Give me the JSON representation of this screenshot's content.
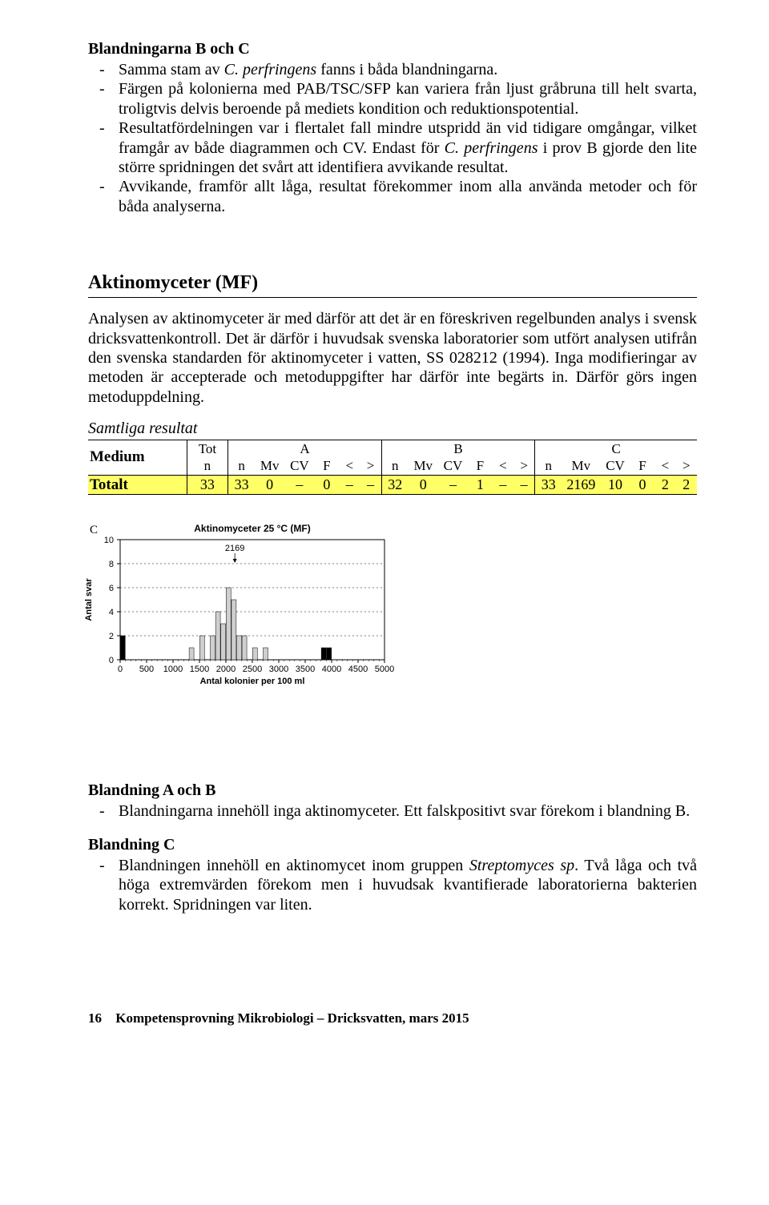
{
  "top": {
    "heading1": "Blandningarna B och C",
    "b1": "Samma stam av ",
    "b1_italic": "C. perfringens",
    "b1_tail": " fanns i båda blandningarna.",
    "b2": "Färgen på kolonierna med PAB/TSC/SFP kan variera från ljust gråbruna till helt svarta, troligtvis delvis beroende på mediets kondition och reduktionspotential.",
    "b3_a": "Resultatfördelningen var i flertalet fall mindre utspridd än vid tidigare omgångar, vilket framgår av både diagrammen och CV. Endast för ",
    "b3_italic": "C. perfringens",
    "b3_b": " i prov B gjorde den lite större spridningen det svårt att identifiera avvikande resultat.",
    "b4": "Avvikande, framför allt låga, resultat förekommer inom alla använda metoder och för båda analyserna."
  },
  "mid": {
    "heading": "Aktinomyceter (MF)",
    "para": "Analysen av aktinomyceter är med därför att det är en föreskriven regelbunden analys i svensk dricksvattenkontroll. Det är därför i huvudsak svenska laboratorier som utfört analysen utifrån den svenska standarden för aktinomyceter i vatten, SS 028212 (1994). Inga modifieringar av metoden är accepterade och metoduppgifter har därför inte begärts in. Därför görs ingen metoduppdelning.",
    "samtliga": "Samtliga resultat"
  },
  "table": {
    "medium": "Medium",
    "tot": "Tot",
    "A": "A",
    "B": "B",
    "C": "C",
    "n": "n",
    "Mv": "Mv",
    "CV": "CV",
    "F": "F",
    "lt": "<",
    "gt": ">",
    "row_label": "Totalt",
    "tot_n": "33",
    "A_vals": {
      "n": "33",
      "Mv": "0",
      "CV": "–",
      "F": "0",
      "lt": "–",
      "gt": "–"
    },
    "B_vals": {
      "n": "32",
      "Mv": "0",
      "CV": "–",
      "F": "1",
      "lt": "–",
      "gt": "–"
    },
    "C_vals": {
      "n": "33",
      "Mv": "2169",
      "CV": "10",
      "F": "0",
      "lt": "2",
      "gt": "2"
    }
  },
  "chart_data": {
    "type": "bar",
    "title": "Aktinomyceter 25 °C (MF)",
    "panel_label": "C",
    "annotation_value": "2169",
    "xlabel": "Antal kolonier per 100 ml",
    "ylabel": "Antal svar",
    "xlim": [
      0,
      5000
    ],
    "ylim": [
      0,
      10
    ],
    "x_ticks": [
      0,
      500,
      1000,
      1500,
      2000,
      2500,
      3000,
      3500,
      4000,
      4500,
      5000
    ],
    "y_ticks": [
      0,
      2,
      4,
      6,
      8,
      10
    ],
    "grid_y": true,
    "bars": [
      {
        "x": 50,
        "y": 2,
        "dark": true
      },
      {
        "x": 1350,
        "y": 1,
        "dark": false
      },
      {
        "x": 1550,
        "y": 2,
        "dark": false
      },
      {
        "x": 1750,
        "y": 2,
        "dark": false
      },
      {
        "x": 1850,
        "y": 4,
        "dark": false
      },
      {
        "x": 1950,
        "y": 3,
        "dark": false
      },
      {
        "x": 2050,
        "y": 6,
        "dark": false
      },
      {
        "x": 2150,
        "y": 5,
        "dark": false
      },
      {
        "x": 2250,
        "y": 2,
        "dark": false
      },
      {
        "x": 2350,
        "y": 2,
        "dark": false
      },
      {
        "x": 2550,
        "y": 1,
        "dark": false
      },
      {
        "x": 2750,
        "y": 1,
        "dark": false
      },
      {
        "x": 3850,
        "y": 1,
        "dark": true
      },
      {
        "x": 3950,
        "y": 1,
        "dark": true
      }
    ]
  },
  "bottom": {
    "h1": "Blandning A och B",
    "b1": "Blandningarna innehöll inga aktinomyceter. Ett falskpositivt svar förekom i blandning B.",
    "h2": "Blandning C",
    "b2_a": "Blandningen innehöll en aktinomycet inom gruppen ",
    "b2_italic": "Streptomyces sp",
    "b2_b": ". Två låga och två höga extremvärden förekom men i huvudsak kvantifierade laboratorierna bakterien korrekt. Spridningen var liten."
  },
  "footer": {
    "page": "16",
    "text": "Kompetensprovning Mikrobiologi – Dricksvatten, mars 2015"
  }
}
